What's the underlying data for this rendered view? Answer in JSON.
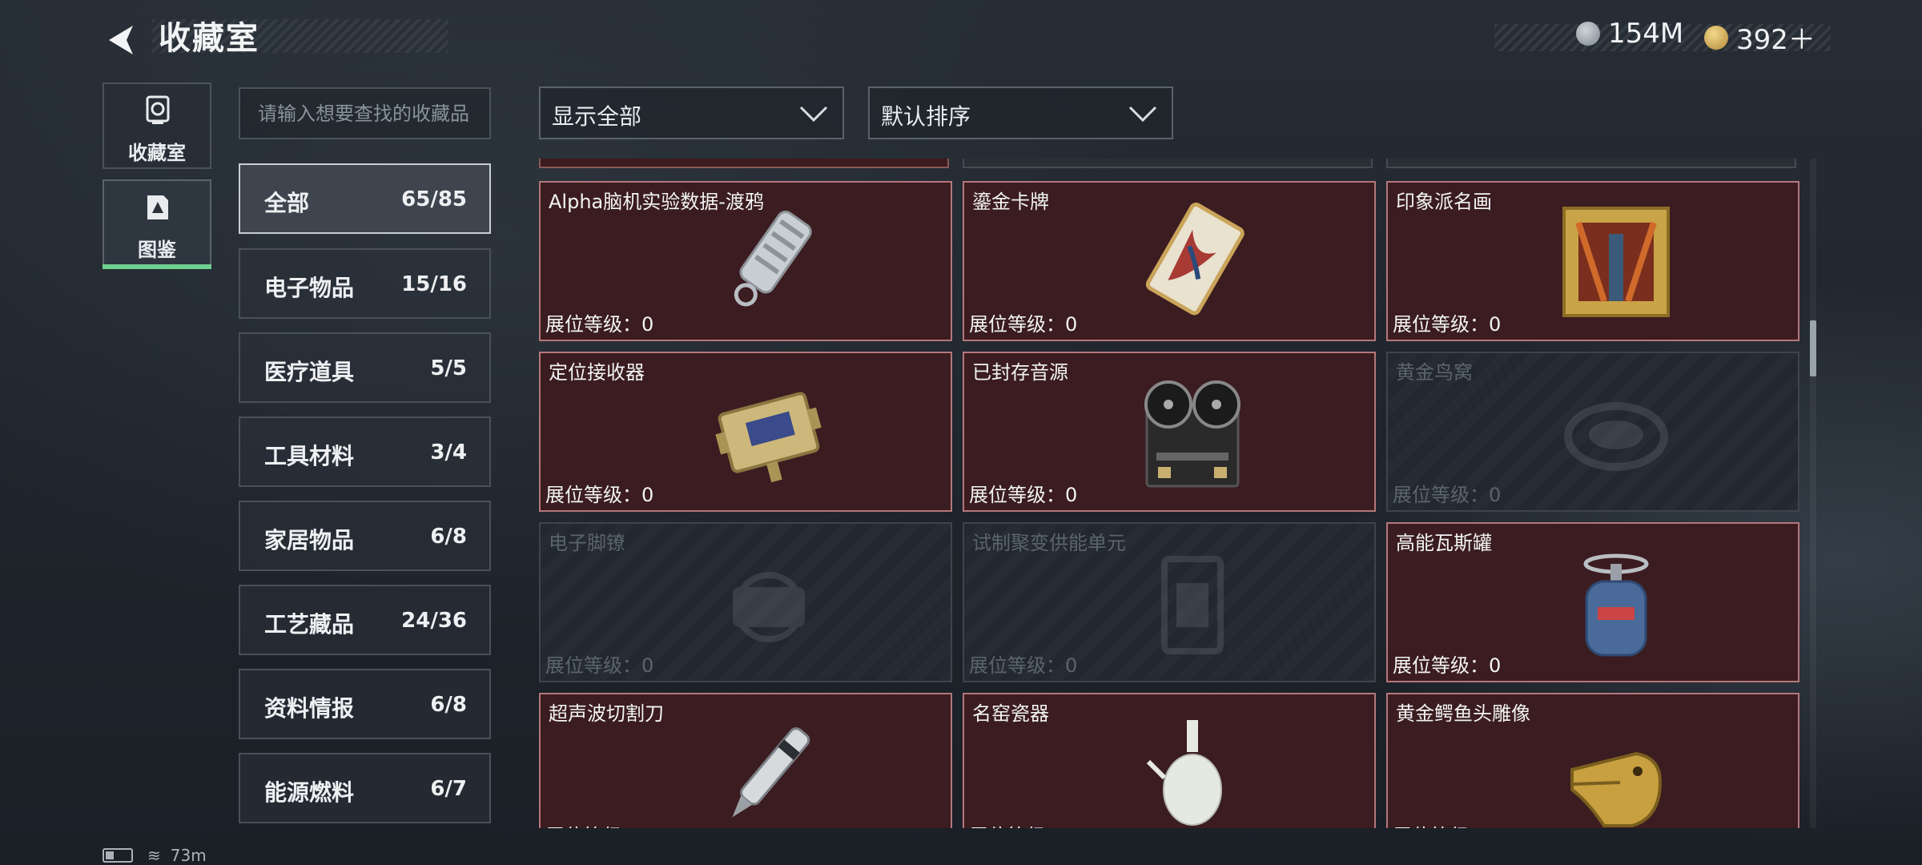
{
  "header": {
    "title": "收藏室",
    "currency": [
      {
        "icon": "silver-coin-icon",
        "value": "154M"
      },
      {
        "icon": "gold-coin-icon",
        "value": "392＋"
      }
    ]
  },
  "left_nav": [
    {
      "label": "收藏室",
      "icon": "collection-room-icon"
    },
    {
      "label": "图鉴",
      "icon": "codex-icon",
      "active": true
    }
  ],
  "search": {
    "placeholder": "请输入想要查找的收藏品"
  },
  "filters": {
    "display": "显示全部",
    "sort": "默认排序"
  },
  "categories": [
    {
      "label": "全部",
      "count": "65/85",
      "active": true
    },
    {
      "label": "电子物品",
      "count": "15/16"
    },
    {
      "label": "医疗道具",
      "count": "5/5"
    },
    {
      "label": "工具材料",
      "count": "3/4"
    },
    {
      "label": "家居物品",
      "count": "6/8"
    },
    {
      "label": "工艺藏品",
      "count": "24/36"
    },
    {
      "label": "资料情报",
      "count": "6/8"
    },
    {
      "label": "能源燃料",
      "count": "6/7"
    }
  ],
  "level_label": "展位等级：0",
  "items": [
    {
      "name": "Alpha脑机实验数据-渡鸦",
      "icon": "usb-drive-icon",
      "locked": false
    },
    {
      "name": "鎏金卡牌",
      "icon": "gilded-card-icon",
      "locked": false
    },
    {
      "name": "印象派名画",
      "icon": "framed-painting-icon",
      "locked": false
    },
    {
      "name": "定位接收器",
      "icon": "locator-receiver-icon",
      "locked": false
    },
    {
      "name": "已封存音源",
      "icon": "reel-to-reel-recorder-icon",
      "locked": false
    },
    {
      "name": "黄金鸟窝",
      "icon": "golden-nest-icon",
      "locked": true
    },
    {
      "name": "电子脚镣",
      "icon": "electronic-anklet-icon",
      "locked": true
    },
    {
      "name": "试制聚变供能单元",
      "icon": "fusion-unit-icon",
      "locked": true
    },
    {
      "name": "高能瓦斯罐",
      "icon": "gas-canister-icon",
      "locked": false
    },
    {
      "name": "超声波切割刀",
      "icon": "ultrasonic-cutter-icon",
      "locked": false
    },
    {
      "name": "名窑瓷器",
      "icon": "porcelain-vase-icon",
      "locked": false
    },
    {
      "name": "黄金鳄鱼头雕像",
      "icon": "golden-crocodile-head-icon",
      "locked": false
    }
  ],
  "status": {
    "signal": "73m"
  }
}
